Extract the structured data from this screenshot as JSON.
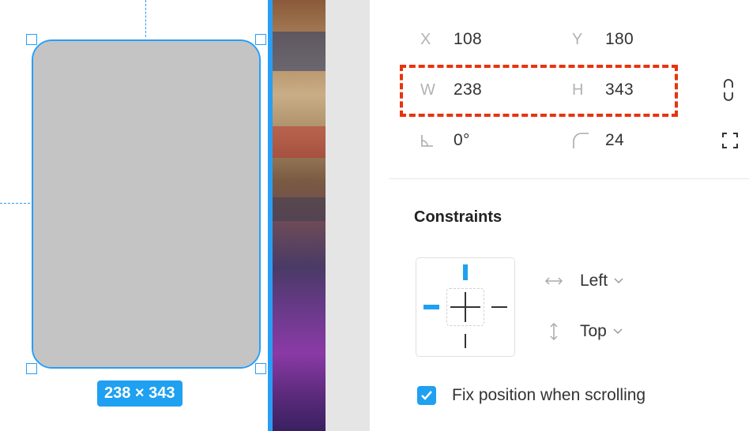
{
  "selection": {
    "size_badge": "238 × 343"
  },
  "position": {
    "x_label": "X",
    "x_value": "108",
    "y_label": "Y",
    "y_value": "180"
  },
  "dimensions": {
    "w_label": "W",
    "w_value": "238",
    "h_label": "H",
    "h_value": "343"
  },
  "transform": {
    "rotation_value": "0°",
    "corner_radius_value": "24"
  },
  "constraints": {
    "title": "Constraints",
    "horizontal": "Left",
    "vertical": "Top"
  },
  "fix_position": {
    "label": "Fix position when scrolling",
    "checked": true
  },
  "colors": {
    "accent": "#1fa0f0",
    "selection": "#2a9df4",
    "highlight": "#e8340f",
    "shape_fill": "#c4c4c4"
  },
  "icons": [
    "rotation-icon",
    "corner-radius-icon",
    "constrain-proportions-icon",
    "independent-corners-icon",
    "horizontal-arrows-icon",
    "vertical-arrows-icon",
    "chevron-down-icon",
    "checkmark-icon"
  ]
}
